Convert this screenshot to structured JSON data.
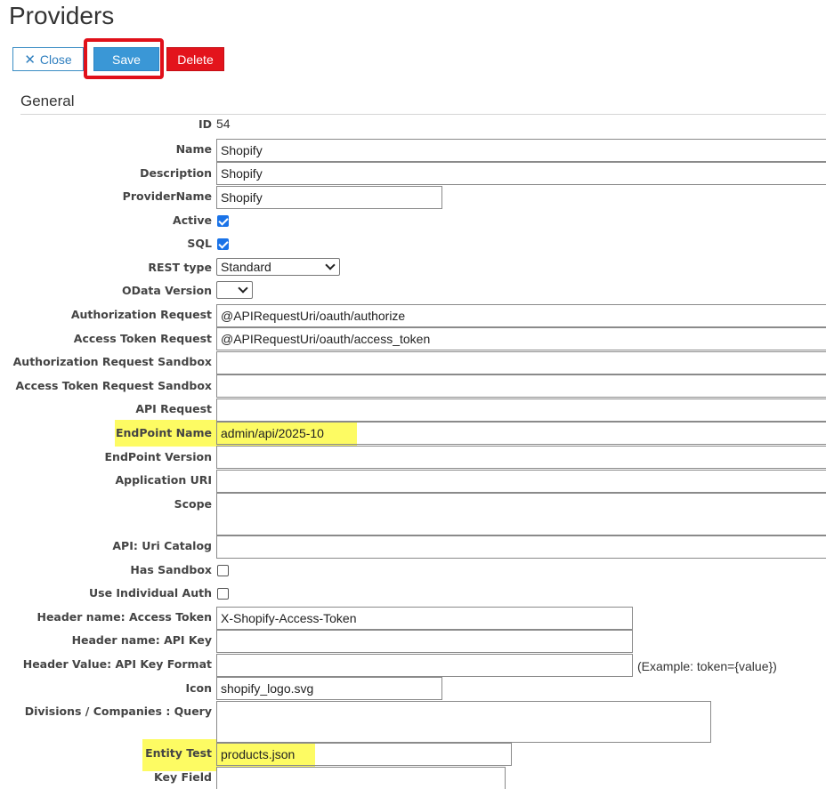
{
  "page": {
    "title": "Providers"
  },
  "toolbar": {
    "close_label": "Close",
    "save_label": "Save",
    "delete_label": "Delete"
  },
  "section": {
    "title": "General"
  },
  "labels": {
    "id": "ID",
    "name": "Name",
    "description": "Description",
    "provider_name": "ProviderName",
    "active": "Active",
    "sql": "SQL",
    "rest_type": "REST type",
    "odata_version": "OData Version",
    "authorization_request": "Authorization Request",
    "access_token_request": "Access Token Request",
    "authorization_request_sandbox": "Authorization Request Sandbox",
    "access_token_request_sandbox": "Access Token Request Sandbox",
    "api_request": "API Request",
    "endpoint_name": "EndPoint Name",
    "endpoint_version": "EndPoint Version",
    "application_uri": "Application URI",
    "scope": "Scope",
    "api_uri_catalog": "API: Uri Catalog",
    "has_sandbox": "Has Sandbox",
    "use_individual_auth": "Use Individual Auth",
    "header_name_access_token": "Header name: Access Token",
    "header_name_api_key": "Header name: API Key",
    "header_value_api_key_format": "Header Value: API Key Format",
    "icon": "Icon",
    "divisions_companies_query": "Divisions / Companies : Query",
    "entity_test": "Entity Test",
    "key_field": "Key Field"
  },
  "values": {
    "id": "54",
    "name": "Shopify",
    "description": "Shopify",
    "provider_name": "Shopify",
    "active": true,
    "sql": true,
    "rest_type": "Standard",
    "odata_version": "",
    "authorization_request": "@APIRequestUri/oauth/authorize",
    "access_token_request": "@APIRequestUri/oauth/access_token",
    "authorization_request_sandbox": "",
    "access_token_request_sandbox": "",
    "api_request": "",
    "endpoint_name": "admin/api/2025-10",
    "endpoint_version": "",
    "application_uri": "",
    "scope": "",
    "api_uri_catalog": "",
    "has_sandbox": false,
    "use_individual_auth": false,
    "header_name_access_token": "X-Shopify-Access-Token",
    "header_name_api_key": "",
    "header_value_api_key_format": "",
    "header_value_api_key_format_hint": "(Example: token={value})",
    "icon": "shopify_logo.svg",
    "divisions_companies_query": "",
    "entity_test": "products.json",
    "key_field": ""
  },
  "colors": {
    "save_button": "#3a97d6",
    "delete_button": "#e3141c",
    "save_highlight_border": "#e0101a",
    "field_highlight": "#fdfb63",
    "checkbox_checked": "#1a73e8"
  },
  "icons": {
    "close": "close-x-icon",
    "select_arrow": "chevron-down-icon"
  }
}
